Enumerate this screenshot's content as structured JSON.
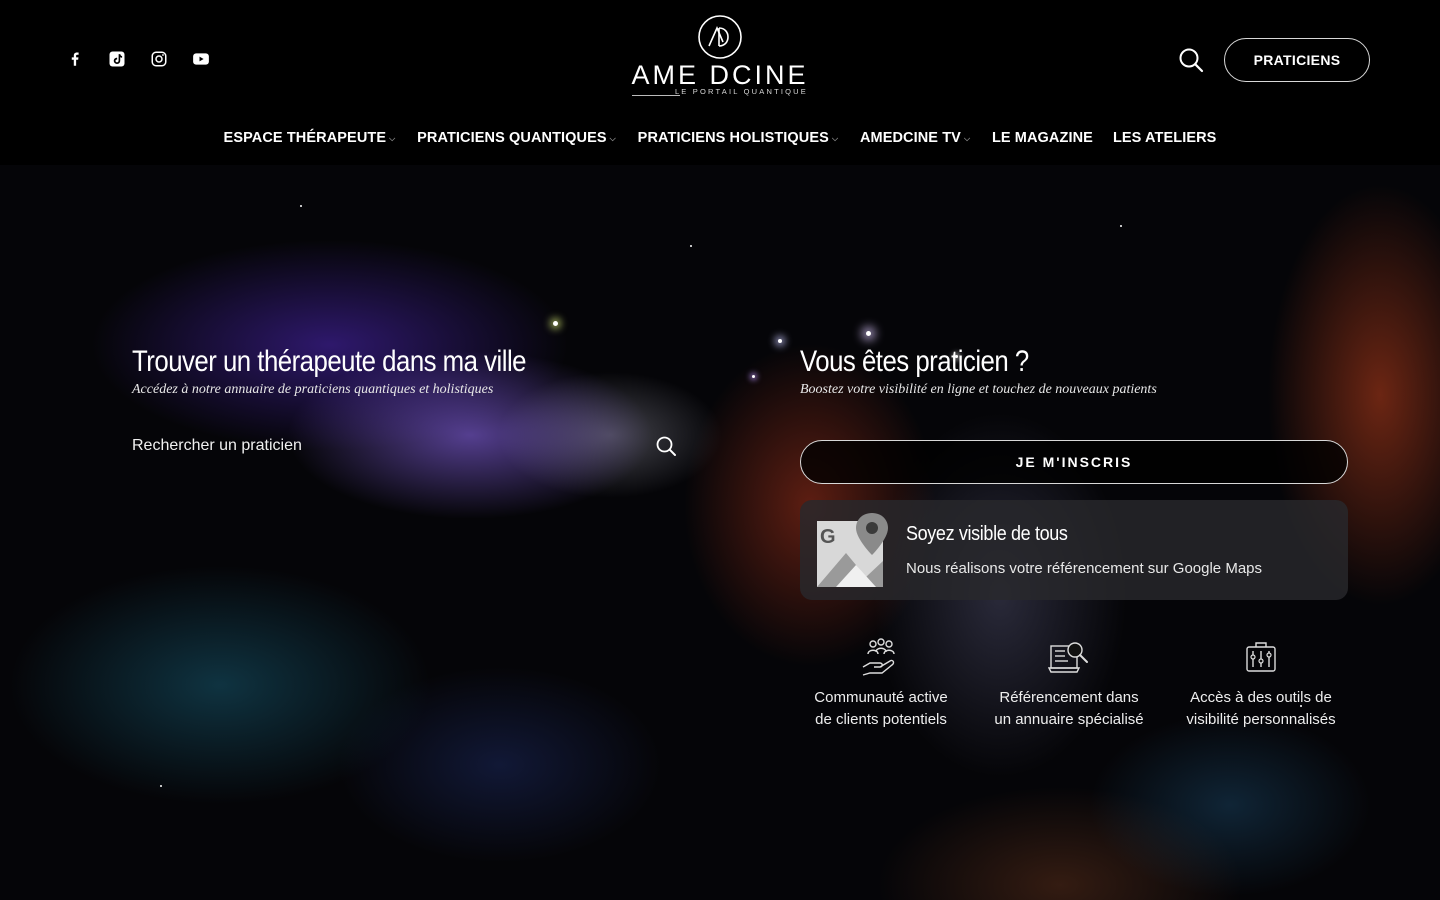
{
  "header": {
    "socials": [
      {
        "name": "facebook-icon"
      },
      {
        "name": "tiktok-icon"
      },
      {
        "name": "instagram-icon"
      },
      {
        "name": "youtube-icon"
      }
    ],
    "logo": {
      "wordmark": "AME DCINE",
      "tagline": "LE PORTAIL QUANTIQUE",
      "monogram": "AD"
    },
    "search_icon": "search-icon",
    "cta_label": "PRATICIENS"
  },
  "nav": {
    "items": [
      {
        "label": "ESPACE THÉRAPEUTE",
        "dropdown": true
      },
      {
        "label": "PRATICIENS QUANTIQUES",
        "dropdown": true
      },
      {
        "label": "PRATICIENS HOLISTIQUES",
        "dropdown": true
      },
      {
        "label": "AMEDCINE TV",
        "dropdown": true
      },
      {
        "label": "LE MAGAZINE",
        "dropdown": false
      },
      {
        "label": "LES ATELIERS",
        "dropdown": false
      }
    ]
  },
  "find": {
    "title": "Trouver un thérapeute dans ma ville",
    "subtitle": "Accédez à notre annuaire de praticiens quantiques et holistiques",
    "search_placeholder": "Rechercher un praticien"
  },
  "practitioner": {
    "title": "Vous êtes praticien ?",
    "subtitle": "Boostez votre visibilité en ligne et touchez de nouveaux patients",
    "signup_label": "JE M'INSCRIS",
    "maps_card": {
      "title": "Soyez visible de tous",
      "description": "Nous réalisons votre référencement sur Google Maps",
      "icon": "google-maps-icon"
    },
    "features": [
      {
        "icon": "community-hand-icon",
        "label": "Communauté active\nde clients potentiels"
      },
      {
        "icon": "directory-search-icon",
        "label": "Référencement dans\nun annuaire spécialisé"
      },
      {
        "icon": "toolbox-icon",
        "label": "Accès à des outils de\nvisibilité personnalisés"
      }
    ]
  }
}
